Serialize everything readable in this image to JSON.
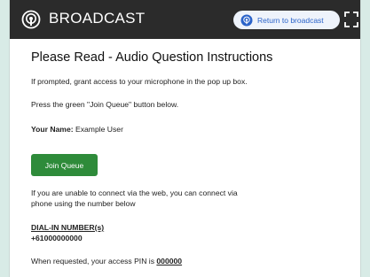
{
  "header": {
    "title": "BROADCAST",
    "return_label": "Return to broadcast",
    "brand_icon": "broadcast-icon",
    "fullscreen_icon": "fullscreen-icon",
    "colors": {
      "bar": "#2b2b2b",
      "accent": "#2a63c9",
      "join": "#2e8b3a"
    }
  },
  "content": {
    "title": "Please Read - Audio Question Instructions",
    "line1": "If prompted, grant access to your microphone in the pop up box.",
    "line2": "Press the green \"Join Queue\" button below.",
    "name_label": "Your Name:",
    "name_value": "Example User",
    "join_label": "Join Queue",
    "phone_line1": "If you are unable to connect via the web, you can connect via",
    "phone_line2": "phone using the number below",
    "dial_label": "DIAL-IN NUMBER(s)",
    "dial_number": "+61000000000",
    "pin_text": "When requested, your access PIN is",
    "pin_value": "000000"
  }
}
